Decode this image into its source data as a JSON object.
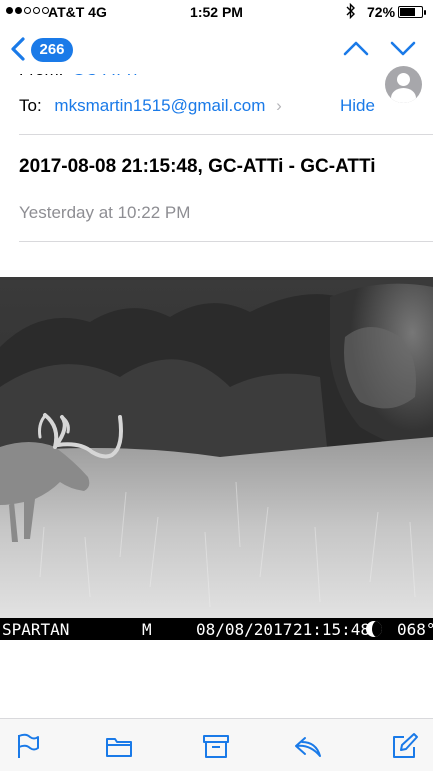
{
  "status_bar": {
    "signal_bars_filled": 2,
    "signal_bars_total": 5,
    "carrier": "AT&T  4G",
    "time": "1:52 PM",
    "bluetooth_icon": "bluetooth-icon",
    "battery_percent": "72%",
    "battery_level": 0.72
  },
  "nav": {
    "back_icon": "chevron-left-icon",
    "unread_count": "266",
    "prev_icon": "chevron-up-icon",
    "next_icon": "chevron-down-icon",
    "accent_color": "#1a7ae8"
  },
  "header": {
    "from_label": "From:",
    "from_address": "GC-ATTi",
    "to_label": "To:",
    "to_address": "mksmartin1515@gmail.com",
    "to_chevron": "›",
    "hide_label": "Hide",
    "avatar_icon": "person-icon"
  },
  "message": {
    "subject": "2017-08-08 21:15:48, GC-ATTi - GC-ATTi",
    "date": "Yesterday at 10:22 PM"
  },
  "photo": {
    "caption": {
      "brand": "SPARTAN",
      "mode": "M",
      "date": "08/08/2017",
      "time": "21:15:48",
      "moon_icon": "moon-phase-icon",
      "temperature": "068°"
    }
  },
  "toolbar": {
    "items": [
      {
        "icon": "flag-icon"
      },
      {
        "icon": "folder-icon"
      },
      {
        "icon": "archive-icon"
      },
      {
        "icon": "reply-icon"
      },
      {
        "icon": "compose-icon"
      }
    ]
  }
}
